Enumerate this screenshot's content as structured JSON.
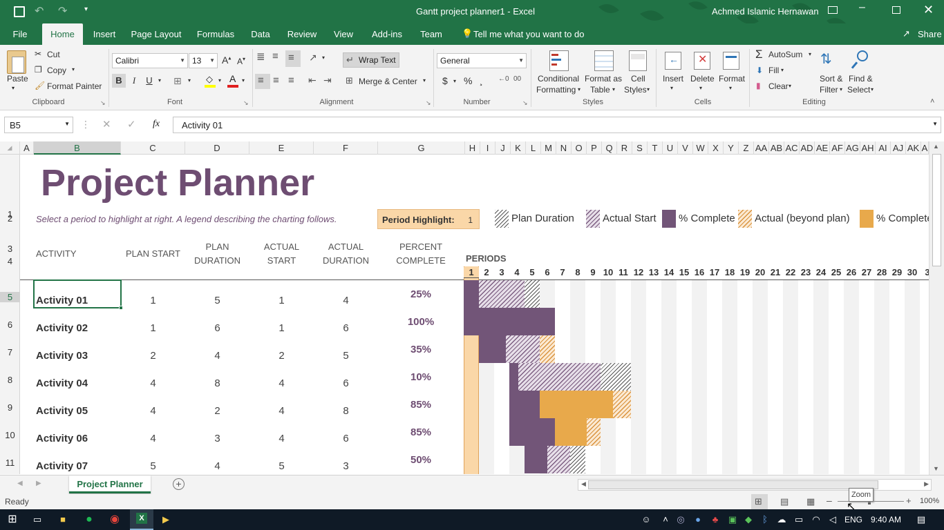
{
  "title_bar": {
    "doc_title": "Gantt project planner1  -  Excel",
    "user": "Achmed Islamic Hernawan",
    "save_icon": "save-icon",
    "undo_icon": "undo-icon",
    "redo_icon": "redo-icon"
  },
  "tabs": [
    "File",
    "Home",
    "Insert",
    "Page Layout",
    "Formulas",
    "Data",
    "Review",
    "View",
    "Add-ins",
    "Team"
  ],
  "tell_me": "Tell me what you want to do",
  "share": "Share",
  "ribbon": {
    "clipboard": {
      "label": "Clipboard",
      "paste": "Paste",
      "cut": "Cut",
      "copy": "Copy",
      "format_painter": "Format Painter"
    },
    "font": {
      "label": "Font",
      "name": "Calibri",
      "size": "13",
      "bold": "B",
      "italic": "I",
      "underline": "U"
    },
    "alignment": {
      "label": "Alignment",
      "wrap_text": "Wrap Text",
      "merge_center": "Merge & Center"
    },
    "number": {
      "label": "Number",
      "format": "General",
      "currency": "$",
      "percent": "%",
      "comma": "¸"
    },
    "styles": {
      "label": "Styles",
      "conditional_1": "Conditional",
      "conditional_2": "Formatting",
      "format_as_1": "Format as",
      "format_as_2": "Table",
      "cell_styles_1": "Cell",
      "cell_styles_2": "Styles"
    },
    "cells": {
      "label": "Cells",
      "insert": "Insert",
      "delete": "Delete",
      "format": "Format"
    },
    "editing": {
      "label": "Editing",
      "autosum": "AutoSum",
      "fill": "Fill",
      "clear": "Clear",
      "sort_1": "Sort &",
      "sort_2": "Filter",
      "find_1": "Find &",
      "find_2": "Select"
    }
  },
  "formula_bar": {
    "name_box": "B5",
    "fx": "fx",
    "content": "Activity 01"
  },
  "columns": [
    "A",
    "B",
    "C",
    "D",
    "E",
    "F",
    "G",
    "H",
    "I",
    "J",
    "K",
    "L",
    "M",
    "N",
    "O",
    "P",
    "Q",
    "R",
    "S",
    "T",
    "U",
    "V",
    "W",
    "X",
    "Y",
    "Z",
    "AA",
    "AB",
    "AC",
    "AD",
    "AE",
    "AF",
    "AG",
    "AH",
    "AI",
    "AJ",
    "AK",
    "A"
  ],
  "rows": [
    "1",
    "2",
    "3",
    "4",
    "5",
    "6",
    "7",
    "8",
    "9",
    "10",
    "11"
  ],
  "sheet": {
    "title": "Project Planner",
    "subtitle": "Select a period to highlight at right.  A legend describing the charting follows.",
    "period_highlight_label": "Period Highlight:",
    "period_highlight_value": "1",
    "legend": [
      "Plan Duration",
      "Actual Start",
      "% Complete",
      "Actual (beyond plan)",
      "% Complete"
    ],
    "headers": {
      "activity": "ACTIVITY",
      "plan_start": "PLAN START",
      "plan_duration": "PLAN\nDURATION",
      "actual_start": "ACTUAL\nSTART",
      "actual_duration": "ACTUAL\nDURATION",
      "percent_complete": "PERCENT\nCOMPLETE",
      "periods": "PERIODS"
    },
    "periods": [
      "1",
      "2",
      "3",
      "4",
      "5",
      "6",
      "7",
      "8",
      "9",
      "10",
      "11",
      "12",
      "13",
      "14",
      "15",
      "16",
      "17",
      "18",
      "19",
      "20",
      "21",
      "22",
      "23",
      "24",
      "25",
      "26",
      "27",
      "28",
      "29",
      "30",
      "3"
    ],
    "activities": [
      {
        "name": "Activity 01",
        "plan_start": "1",
        "plan_duration": "5",
        "actual_start": "1",
        "actual_duration": "4",
        "percent": "25%"
      },
      {
        "name": "Activity 02",
        "plan_start": "1",
        "plan_duration": "6",
        "actual_start": "1",
        "actual_duration": "6",
        "percent": "100%"
      },
      {
        "name": "Activity 03",
        "plan_start": "2",
        "plan_duration": "4",
        "actual_start": "2",
        "actual_duration": "5",
        "percent": "35%"
      },
      {
        "name": "Activity 04",
        "plan_start": "4",
        "plan_duration": "8",
        "actual_start": "4",
        "actual_duration": "6",
        "percent": "10%"
      },
      {
        "name": "Activity 05",
        "plan_start": "4",
        "plan_duration": "2",
        "actual_start": "4",
        "actual_duration": "8",
        "percent": "85%"
      },
      {
        "name": "Activity 06",
        "plan_start": "4",
        "plan_duration": "3",
        "actual_start": "4",
        "actual_duration": "6",
        "percent": "85%"
      },
      {
        "name": "Activity 07",
        "plan_start": "5",
        "plan_duration": "4",
        "actual_start": "5",
        "actual_duration": "3",
        "percent": "50%"
      }
    ]
  },
  "sheet_tabs": [
    "Project Planner"
  ],
  "status": {
    "ready": "Ready",
    "zoom_tooltip": "Zoom",
    "zoom_level": "100%"
  },
  "taskbar": {
    "lang": "ENG",
    "time": "9:40 AM"
  }
}
